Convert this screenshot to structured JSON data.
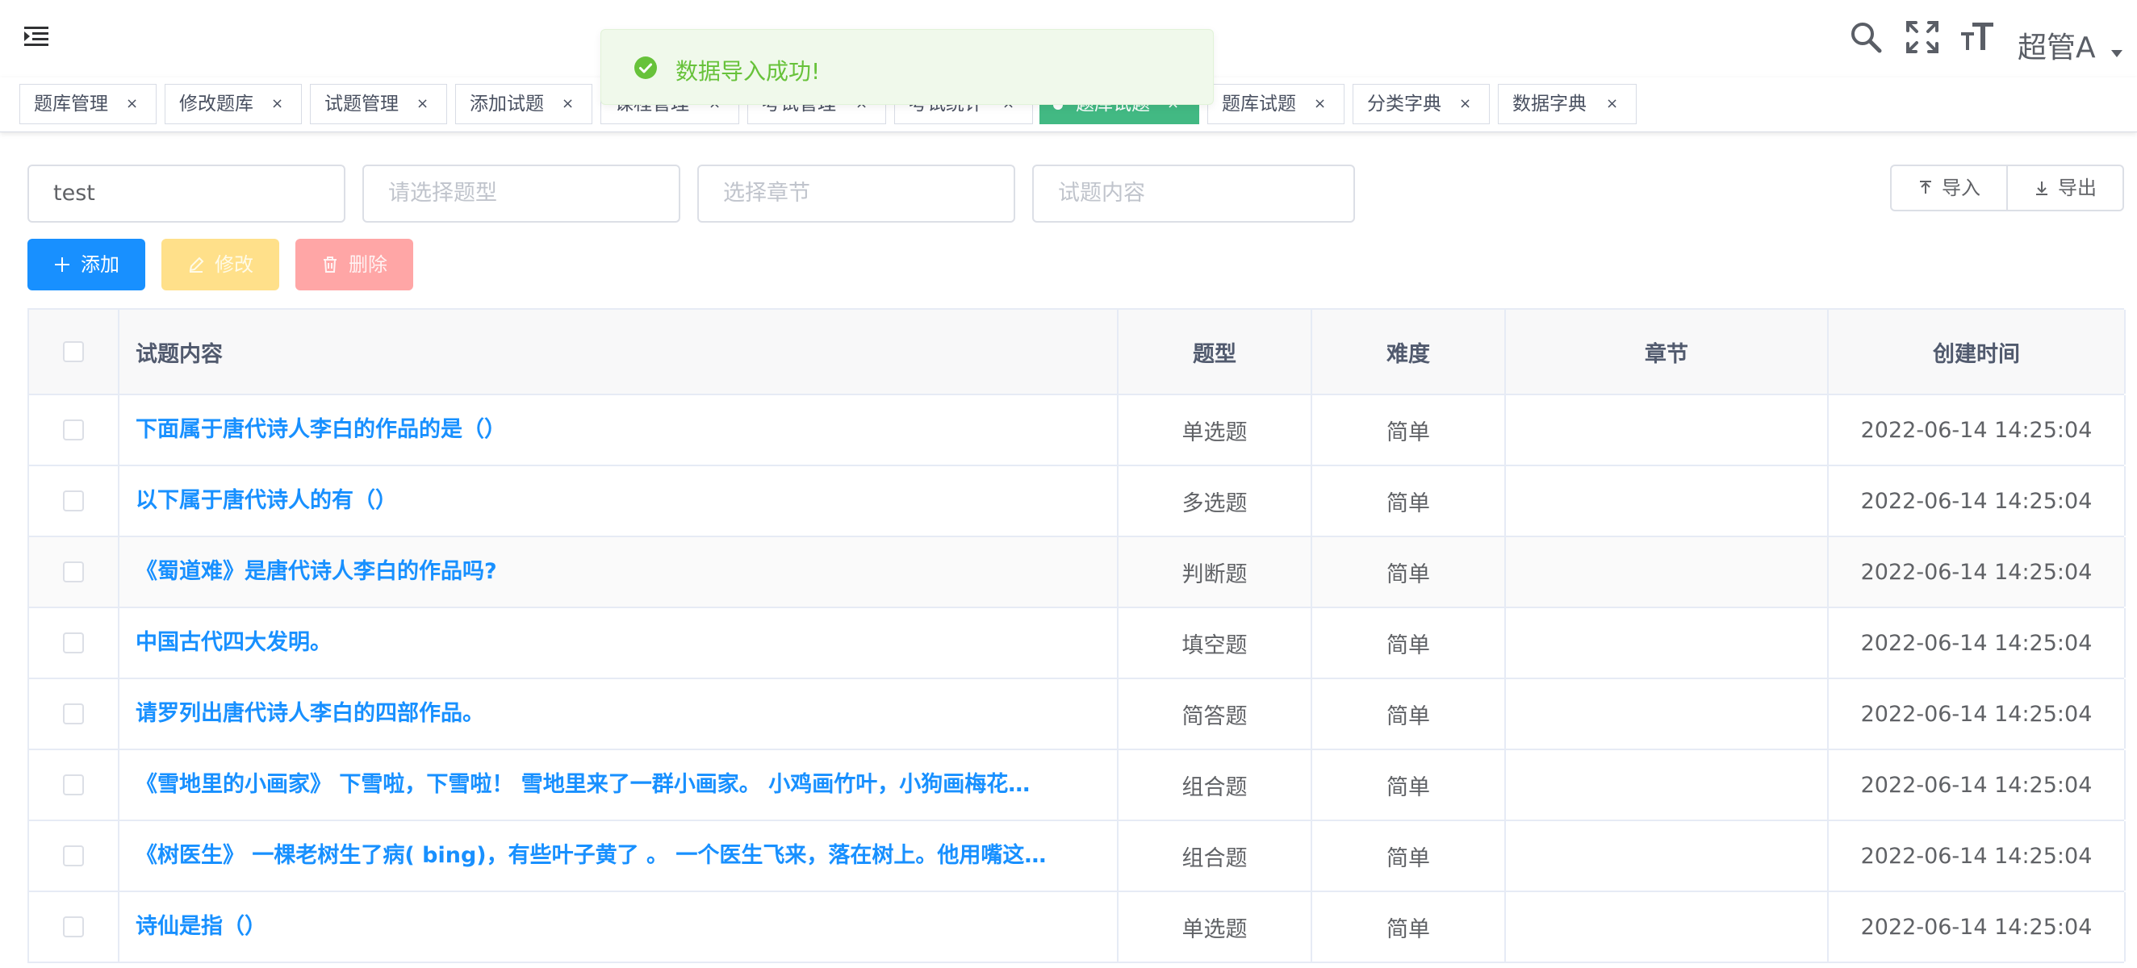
{
  "toast": {
    "message": "数据导入成功!",
    "color": "#67c23a"
  },
  "user": {
    "name": "超管A"
  },
  "tags": [
    {
      "label": "题库管理",
      "active": false
    },
    {
      "label": "修改题库",
      "active": false
    },
    {
      "label": "试题管理",
      "active": false
    },
    {
      "label": "添加试题",
      "active": false
    },
    {
      "label": "课程管理",
      "active": false
    },
    {
      "label": "考试管理",
      "active": false
    },
    {
      "label": "考试统计",
      "active": false
    },
    {
      "label": "题库试题",
      "active": true
    },
    {
      "label": "题库试题",
      "active": false
    },
    {
      "label": "分类字典",
      "active": false
    },
    {
      "label": "数据字典",
      "active": false
    }
  ],
  "search": {
    "bank": {
      "value": "test"
    },
    "type": {
      "placeholder": "请选择题型"
    },
    "chapter": {
      "placeholder": "选择章节"
    },
    "content": {
      "placeholder": "试题内容"
    }
  },
  "toolbar": {
    "import_label": "导入",
    "export_label": "导出",
    "add_label": "添加",
    "edit_label": "修改",
    "delete_label": "删除"
  },
  "table": {
    "headers": [
      "试题内容",
      "题型",
      "难度",
      "章节",
      "创建时间"
    ],
    "rows": [
      {
        "content": "下面属于唐代诗人李白的作品的是（）",
        "type": "单选题",
        "difficulty": "简单",
        "chapter": "",
        "created": "2022-06-14 14:25:04"
      },
      {
        "content": "以下属于唐代诗人的有（）",
        "type": "多选题",
        "difficulty": "简单",
        "chapter": "",
        "created": "2022-06-14 14:25:04"
      },
      {
        "content": "《蜀道难》是唐代诗人李白的作品吗?",
        "type": "判断题",
        "difficulty": "简单",
        "chapter": "",
        "created": "2022-06-14 14:25:04"
      },
      {
        "content": "中国古代四大发明。",
        "type": "填空题",
        "difficulty": "简单",
        "chapter": "",
        "created": "2022-06-14 14:25:04"
      },
      {
        "content": "请罗列出唐代诗人李白的四部作品。",
        "type": "简答题",
        "difficulty": "简单",
        "chapter": "",
        "created": "2022-06-14 14:25:04"
      },
      {
        "content": "《雪地里的小画家》 下雪啦，下雪啦！ 雪地里来了一群小画家。 小鸡画竹叶，小狗画梅花…",
        "type": "组合题",
        "difficulty": "简单",
        "chapter": "",
        "created": "2022-06-14 14:25:04"
      },
      {
        "content": "《树医生》 一棵老树生了病( bing)，有些叶子黄了 。 一个医生飞来，落在树上。他用嘴这…",
        "type": "组合题",
        "difficulty": "简单",
        "chapter": "",
        "created": "2022-06-14 14:25:04"
      },
      {
        "content": "诗仙是指（）",
        "type": "单选题",
        "difficulty": "简单",
        "chapter": "",
        "created": "2022-06-14 14:25:04"
      }
    ]
  },
  "icons": {
    "menu": "hamburger-icon",
    "search": "search-icon",
    "fullscreen": "fullscreen-icon",
    "font_size": "font-size-icon",
    "success": "check-circle-icon",
    "upload": "upload-icon",
    "download": "download-icon",
    "plus": "plus-icon",
    "edit": "edit-icon",
    "delete": "trash-icon"
  },
  "colors": {
    "primary": "#1890ff",
    "tag_active": "#42b983",
    "warning_disabled": "#ffe08a",
    "danger_disabled": "#ffa6a6"
  }
}
